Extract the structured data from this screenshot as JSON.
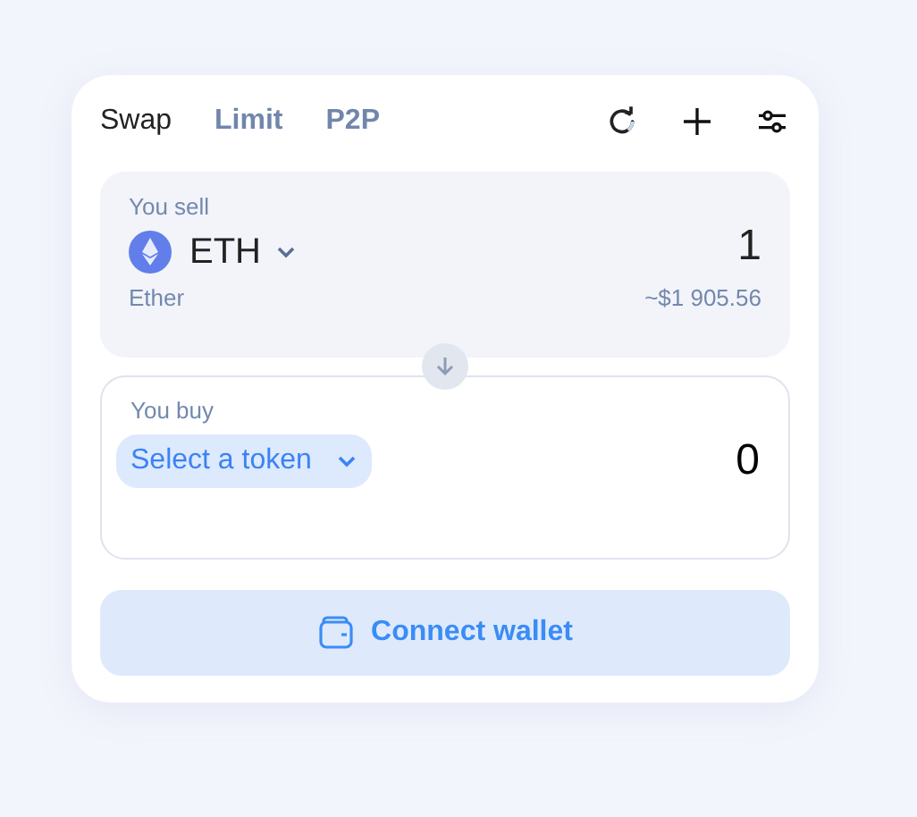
{
  "tabs": [
    {
      "label": "Swap",
      "selected": true
    },
    {
      "label": "Limit",
      "selected": false
    },
    {
      "label": "P2P",
      "selected": false
    }
  ],
  "panels": [
    {
      "kind": "sell",
      "label": "You sell",
      "token": "ETH",
      "amount": "1",
      "token_name": "Ether",
      "fiat": "~$1 905.56"
    },
    {
      "kind": "buy",
      "label": "You buy",
      "token_placeholder": "Select a token",
      "amount": "0"
    }
  ],
  "connect_button": "Connect wallet"
}
